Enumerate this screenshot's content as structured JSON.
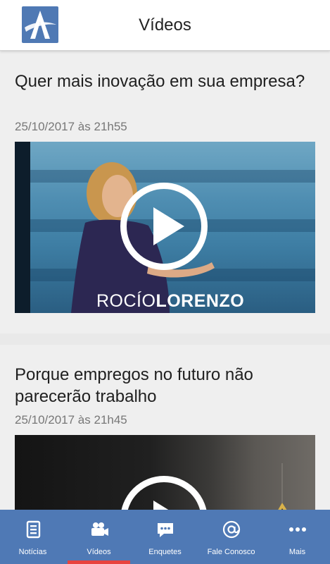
{
  "header": {
    "title": "Vídeos",
    "logo": "app-logo-icon"
  },
  "feed": {
    "items": [
      {
        "title": "Quer mais inovação em sua empresa?",
        "date": "25/10/2017 às 21h55",
        "overlay_first": "ROCÍO",
        "overlay_last": "LORENZO"
      },
      {
        "title": "Porque empregos no futuro não parecerão trabalho",
        "date": "25/10/2017 às 21h45"
      }
    ]
  },
  "tabs": [
    {
      "label": "Notícias",
      "icon": "newspaper-icon"
    },
    {
      "label": "Vídeos",
      "icon": "video-camera-icon",
      "active": true
    },
    {
      "label": "Enquetes",
      "icon": "chat-bubble-icon"
    },
    {
      "label": "Fale Conosco",
      "icon": "at-sign-icon"
    },
    {
      "label": "Mais",
      "icon": "more-dots-icon"
    }
  ],
  "colors": {
    "accent": "#4f79b5",
    "active_indicator": "#e8433e"
  }
}
